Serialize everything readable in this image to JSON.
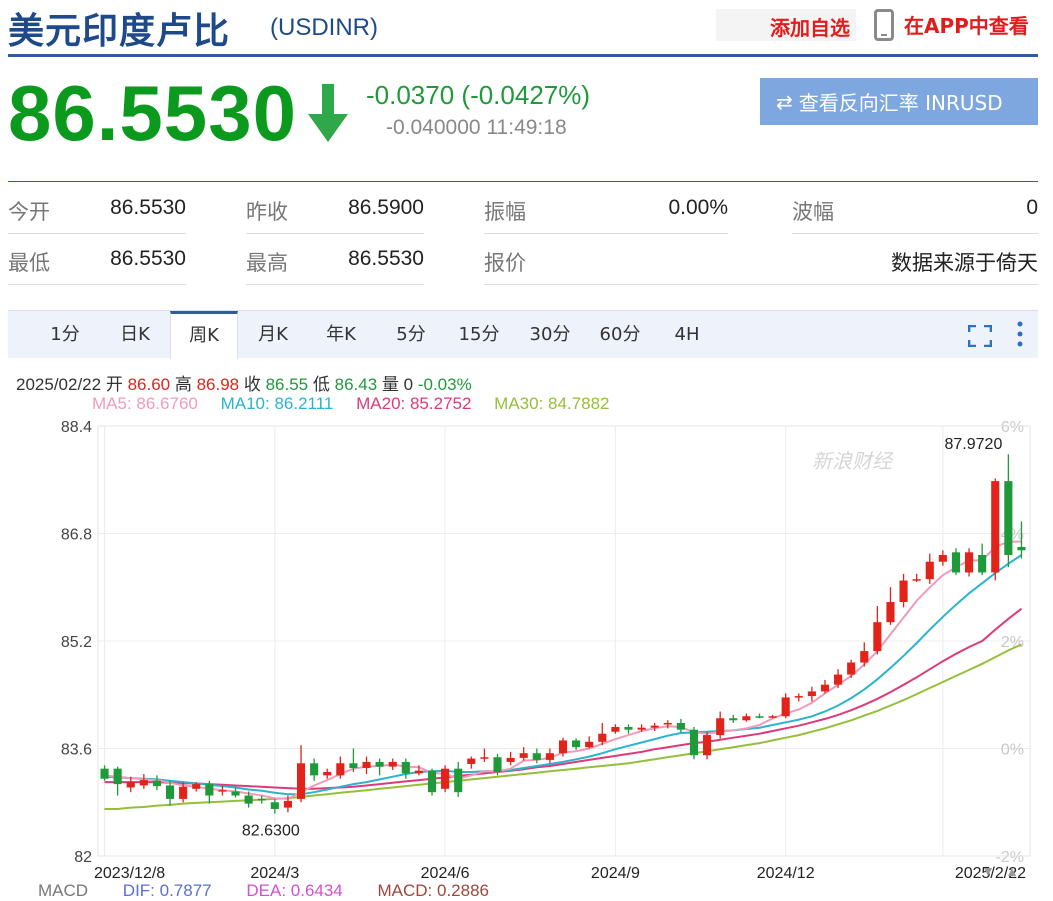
{
  "header": {
    "title": "美元印度卢比",
    "code": "(USDINR)",
    "add_watchlist": "添加自选",
    "app_link": "在APP中查看"
  },
  "quote": {
    "price": "86.5530",
    "change": "-0.0370 (-0.0427%)",
    "sub_change": "-0.040000",
    "time": "11:49:18",
    "reverse_button": "查看反向汇率 INRUSD",
    "direction": "down"
  },
  "stats": [
    {
      "label": "今开",
      "value": "86.5530"
    },
    {
      "label": "昨收",
      "value": "86.5900"
    },
    {
      "label": "振幅",
      "value": "0.00%"
    },
    {
      "label": "波幅",
      "value": "0"
    },
    {
      "label": "最低",
      "value": "86.5530"
    },
    {
      "label": "最高",
      "value": "86.5530"
    },
    {
      "label": "报价",
      "value": "数据来源于倚天"
    }
  ],
  "tabs": [
    "1分",
    "日K",
    "周K",
    "月K",
    "年K",
    "5分",
    "15分",
    "30分",
    "60分",
    "4H"
  ],
  "active_tab": "周K",
  "info": {
    "date": "2025/02/22",
    "open_label": "开",
    "open": "86.60",
    "high_label": "高",
    "high": "86.98",
    "close_label": "收",
    "close": "86.55",
    "low_label": "低",
    "low": "86.43",
    "vol_label": "量",
    "vol": "0",
    "pct": "-0.03%",
    "ma5": "MA5: 86.6760",
    "ma10": "MA10: 86.2111",
    "ma20": "MA20: 85.2752",
    "ma30": "MA30: 84.7882"
  },
  "macd": {
    "label": "MACD",
    "dif": "DIF: 0.7877",
    "dea": "DEA: 0.6434",
    "macd": "MACD: 0.2886"
  },
  "colors": {
    "up": "#e2231a",
    "down": "#1f9a3a",
    "ma5": "#f09bbb",
    "ma10": "#2bb3cf",
    "ma20": "#de3a78",
    "ma30": "#95bf3a",
    "accent": "#2e5c9e"
  },
  "chart_data": {
    "type": "candlestick",
    "y_ticks": [
      "88.4",
      "86.8",
      "85.2",
      "83.6",
      "82"
    ],
    "ylim": [
      82,
      88.4
    ],
    "pct_ticks": [
      "6%",
      "4%",
      "2%",
      "0%",
      "-2%"
    ],
    "x_labels": [
      "2023/12/8",
      "2024/3",
      "2024/6",
      "2024/9",
      "2024/12",
      "2025/2/22"
    ],
    "x_label_index": [
      0,
      13,
      26,
      39,
      52,
      64
    ],
    "max_label": "87.9720",
    "min_label": "82.6300",
    "watermark": "新浪财经",
    "candles": [
      [
        83.3,
        83.15,
        83.35,
        83.12
      ],
      [
        83.3,
        83.07,
        83.33,
        82.9
      ],
      [
        83.02,
        83.1,
        83.18,
        82.95
      ],
      [
        83.05,
        83.13,
        83.22,
        83.0
      ],
      [
        83.12,
        83.04,
        83.2,
        82.98
      ],
      [
        83.05,
        82.85,
        83.12,
        82.75
      ],
      [
        82.85,
        83.03,
        83.1,
        82.8
      ],
      [
        83.0,
        83.07,
        83.1,
        82.96
      ],
      [
        83.07,
        82.9,
        83.12,
        82.78
      ],
      [
        82.96,
        82.98,
        83.05,
        82.9
      ],
      [
        82.96,
        82.9,
        83.02,
        82.87
      ],
      [
        82.9,
        82.78,
        82.96,
        82.72
      ],
      [
        82.85,
        82.83,
        82.9,
        82.78
      ],
      [
        82.8,
        82.7,
        82.85,
        82.63
      ],
      [
        82.72,
        82.82,
        82.9,
        82.65
      ],
      [
        82.85,
        83.38,
        83.65,
        82.8
      ],
      [
        83.38,
        83.2,
        83.45,
        83.12
      ],
      [
        83.2,
        83.25,
        83.3,
        83.15
      ],
      [
        83.2,
        83.38,
        83.48,
        83.15
      ],
      [
        83.38,
        83.31,
        83.6,
        83.25
      ],
      [
        83.31,
        83.4,
        83.48,
        83.22
      ],
      [
        83.4,
        83.33,
        83.45,
        83.2
      ],
      [
        83.33,
        83.4,
        83.45,
        83.28
      ],
      [
        83.4,
        83.23,
        83.45,
        83.15
      ],
      [
        83.23,
        83.27,
        83.35,
        83.2
      ],
      [
        83.27,
        82.95,
        83.3,
        82.9
      ],
      [
        83.0,
        83.3,
        83.35,
        82.95
      ],
      [
        83.3,
        82.95,
        83.4,
        82.88
      ],
      [
        83.37,
        83.45,
        83.48,
        83.3
      ],
      [
        83.45,
        83.47,
        83.6,
        83.4
      ],
      [
        83.47,
        83.25,
        83.52,
        83.2
      ],
      [
        83.4,
        83.46,
        83.55,
        83.35
      ],
      [
        83.46,
        83.53,
        83.62,
        83.42
      ],
      [
        83.53,
        83.43,
        83.6,
        83.38
      ],
      [
        83.43,
        83.53,
        83.6,
        83.38
      ],
      [
        83.53,
        83.72,
        83.76,
        83.48
      ],
      [
        83.72,
        83.62,
        83.75,
        83.58
      ],
      [
        83.62,
        83.7,
        83.78,
        83.6
      ],
      [
        83.7,
        83.82,
        83.98,
        83.65
      ],
      [
        83.85,
        83.92,
        83.96,
        83.82
      ],
      [
        83.92,
        83.88,
        83.96,
        83.82
      ],
      [
        83.88,
        83.91,
        83.96,
        83.85
      ],
      [
        83.91,
        83.94,
        83.98,
        83.86
      ],
      [
        83.96,
        83.98,
        84.02,
        83.9
      ],
      [
        83.98,
        83.88,
        84.04,
        83.84
      ],
      [
        83.88,
        83.5,
        83.92,
        83.44
      ],
      [
        83.5,
        83.8,
        83.85,
        83.44
      ],
      [
        83.8,
        84.05,
        84.15,
        83.75
      ],
      [
        84.05,
        84.02,
        84.1,
        83.98
      ],
      [
        84.02,
        84.08,
        84.12,
        84.0
      ],
      [
        84.08,
        84.07,
        84.12,
        84.05
      ],
      [
        84.07,
        84.08,
        84.1,
        84.05
      ],
      [
        84.08,
        84.36,
        84.42,
        84.05
      ],
      [
        84.36,
        84.38,
        84.42,
        84.3
      ],
      [
        84.38,
        84.45,
        84.52,
        84.3
      ],
      [
        84.45,
        84.55,
        84.62,
        84.42
      ],
      [
        84.55,
        84.7,
        84.78,
        84.5
      ],
      [
        84.7,
        84.88,
        84.92,
        84.65
      ],
      [
        84.88,
        85.05,
        85.18,
        84.82
      ],
      [
        85.05,
        85.48,
        85.72,
        85.0
      ],
      [
        85.48,
        85.78,
        86.0,
        85.44
      ],
      [
        85.78,
        86.1,
        86.2,
        85.7
      ],
      [
        86.1,
        86.12,
        86.2,
        86.08
      ],
      [
        86.12,
        86.38,
        86.5,
        86.05
      ],
      [
        86.38,
        86.48,
        86.55,
        86.32
      ],
      [
        86.52,
        86.22,
        86.58,
        86.18
      ],
      [
        86.22,
        86.52,
        86.58,
        86.16
      ],
      [
        86.48,
        86.22,
        86.65,
        86.18
      ],
      [
        86.22,
        87.58,
        87.62,
        86.1
      ],
      [
        87.58,
        86.48,
        87.98,
        86.3
      ],
      [
        86.6,
        86.55,
        86.98,
        86.43
      ]
    ],
    "ma5": [
      83.2,
      83.18,
      83.16,
      83.14,
      83.13,
      83.09,
      83.05,
      83.03,
      83.0,
      82.98,
      82.96,
      82.93,
      82.9,
      82.86,
      82.85,
      82.95,
      83.05,
      83.13,
      83.22,
      83.3,
      83.33,
      83.34,
      83.36,
      83.33,
      83.32,
      83.24,
      83.22,
      83.15,
      83.2,
      83.26,
      83.26,
      83.3,
      83.42,
      83.43,
      83.46,
      83.54,
      83.56,
      83.6,
      83.67,
      83.74,
      83.8,
      83.86,
      83.9,
      83.93,
      83.92,
      83.84,
      83.82,
      83.85,
      83.87,
      83.9,
      83.95,
      84.05,
      84.12,
      84.18,
      84.28,
      84.42,
      84.55,
      84.68,
      84.85,
      85.05,
      85.3,
      85.55,
      85.8,
      86.0,
      86.18,
      86.3,
      86.4,
      86.4,
      86.6,
      86.68,
      86.68
    ],
    "ma10": [
      83.18,
      83.17,
      83.16,
      83.15,
      83.14,
      83.12,
      83.1,
      83.08,
      83.06,
      83.04,
      83.02,
      82.99,
      82.97,
      82.94,
      82.92,
      82.92,
      82.95,
      82.99,
      83.03,
      83.07,
      83.1,
      83.14,
      83.18,
      83.22,
      83.25,
      83.26,
      83.27,
      83.25,
      83.25,
      83.26,
      83.26,
      83.28,
      83.31,
      83.34,
      83.37,
      83.4,
      83.44,
      83.48,
      83.53,
      83.59,
      83.64,
      83.69,
      83.74,
      83.79,
      83.83,
      83.84,
      83.85,
      83.86,
      83.87,
      83.89,
      83.91,
      83.95,
      83.99,
      84.03,
      84.08,
      84.15,
      84.24,
      84.35,
      84.48,
      84.63,
      84.8,
      84.98,
      85.17,
      85.37,
      85.56,
      85.74,
      85.91,
      86.06,
      86.21,
      86.35,
      86.48
    ],
    "ma20": [
      83.1,
      83.1,
      83.1,
      83.1,
      83.1,
      83.09,
      83.08,
      83.08,
      83.07,
      83.06,
      83.05,
      83.04,
      83.03,
      83.02,
      83.01,
      83.0,
      83.0,
      83.01,
      83.02,
      83.03,
      83.05,
      83.07,
      83.09,
      83.11,
      83.13,
      83.15,
      83.17,
      83.19,
      83.21,
      83.23,
      83.25,
      83.27,
      83.29,
      83.32,
      83.34,
      83.37,
      83.4,
      83.43,
      83.46,
      83.49,
      83.52,
      83.55,
      83.59,
      83.62,
      83.65,
      83.68,
      83.7,
      83.73,
      83.76,
      83.79,
      83.82,
      83.86,
      83.9,
      83.94,
      83.99,
      84.04,
      84.1,
      84.17,
      84.25,
      84.34,
      84.44,
      84.55,
      84.66,
      84.78,
      84.9,
      85.01,
      85.11,
      85.2,
      85.37,
      85.53,
      85.68
    ],
    "ma30": [
      82.7,
      82.7,
      82.72,
      82.73,
      82.75,
      82.76,
      82.78,
      82.79,
      82.8,
      82.81,
      82.82,
      82.83,
      82.84,
      82.85,
      82.86,
      82.88,
      82.9,
      82.92,
      82.94,
      82.96,
      82.98,
      83.0,
      83.02,
      83.04,
      83.06,
      83.08,
      83.1,
      83.12,
      83.14,
      83.16,
      83.18,
      83.2,
      83.22,
      83.24,
      83.26,
      83.28,
      83.3,
      83.32,
      83.34,
      83.36,
      83.38,
      83.41,
      83.44,
      83.47,
      83.5,
      83.53,
      83.56,
      83.59,
      83.62,
      83.65,
      83.68,
      83.72,
      83.76,
      83.8,
      83.85,
      83.9,
      83.96,
      84.02,
      84.09,
      84.16,
      84.24,
      84.32,
      84.41,
      84.5,
      84.59,
      84.68,
      84.77,
      84.86,
      84.96,
      85.06,
      85.15
    ]
  }
}
